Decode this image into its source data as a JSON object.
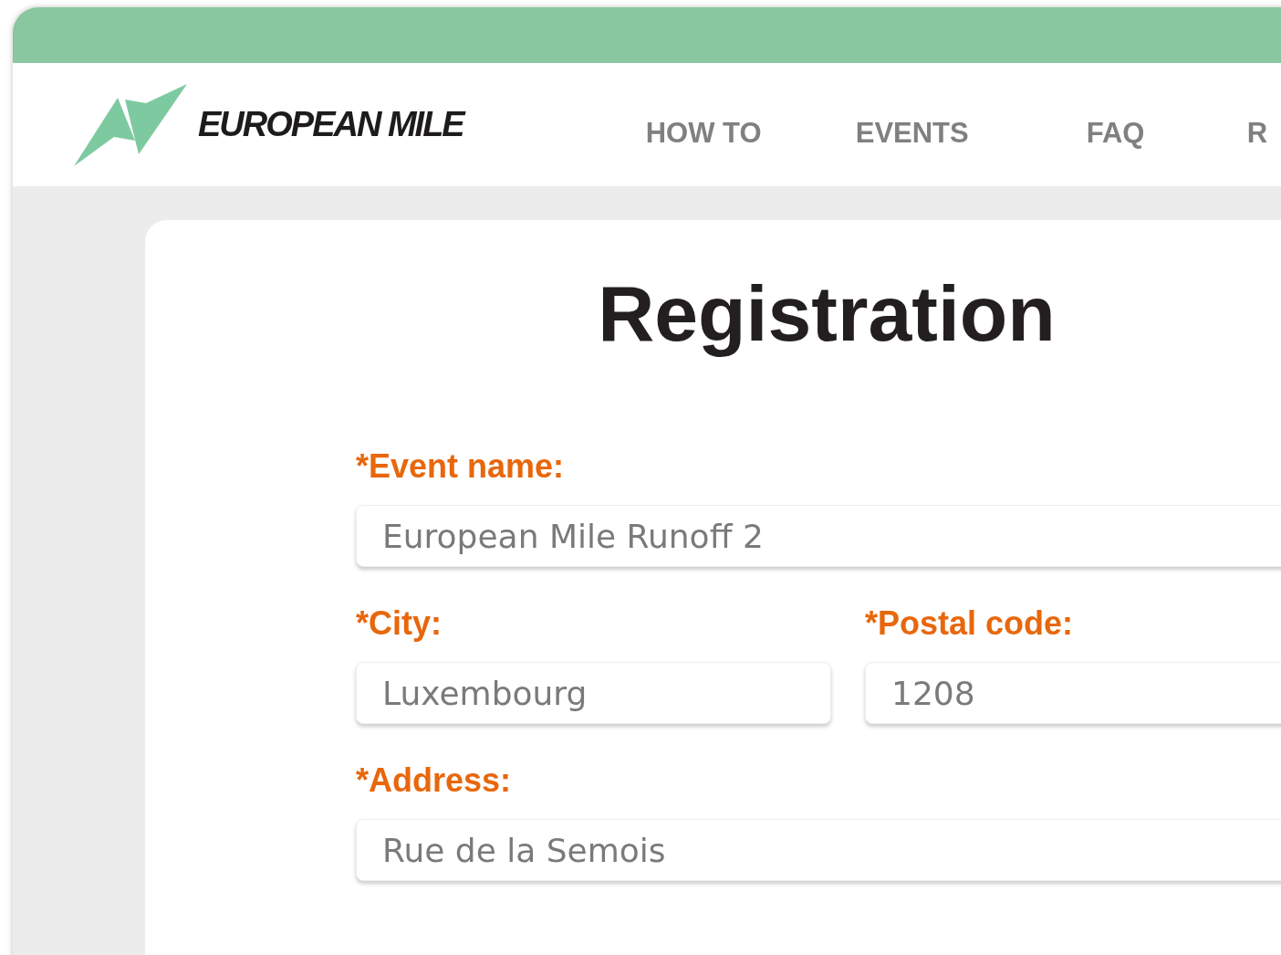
{
  "brand": {
    "name": "EUROPEAN MILE"
  },
  "nav": [
    "HOW TO",
    "EVENTS",
    "FAQ",
    "R"
  ],
  "page": {
    "title": "Registration"
  },
  "form": {
    "rows": [
      [
        {
          "label": "*Event name:",
          "value": "European Mile Runoff 2"
        }
      ],
      [
        {
          "label": "*City:",
          "value": "Luxembourg"
        },
        {
          "label": "*Postal code:",
          "value": "1208"
        }
      ],
      [
        {
          "label": "*Address:",
          "value": "Rue de la Semois"
        }
      ]
    ]
  }
}
